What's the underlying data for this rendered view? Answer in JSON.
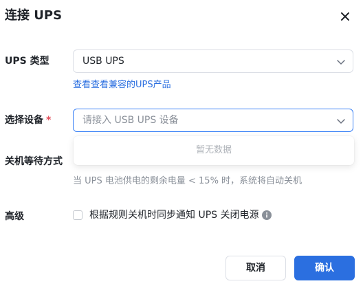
{
  "dialog": {
    "title": "连接 UPS",
    "close_icon": "close-icon"
  },
  "ups_type": {
    "label": "UPS 类型",
    "value": "USB UPS",
    "link_prefix": "查看",
    "link_text": "查看兼容的UPS产品"
  },
  "device": {
    "label": "选择设备",
    "required_mark": "*",
    "placeholder": "请接入 USB UPS 设备",
    "dropdown_empty": "暂无数据"
  },
  "shutdown": {
    "label": "关机等待方式",
    "hint": "当 UPS 电池供电的剩余电量 < 15% 时，系统将自动关机"
  },
  "advanced": {
    "label": "高级",
    "checkbox_label": "根据规则关机时同步通知 UPS 关闭电源",
    "checked": false,
    "info_icon": "info-icon"
  },
  "footer": {
    "cancel_label": "取消",
    "ok_label": "确认"
  },
  "colors": {
    "primary": "#2b6fe0",
    "required": "#e34d59",
    "focus_border": "#3b82f6"
  }
}
